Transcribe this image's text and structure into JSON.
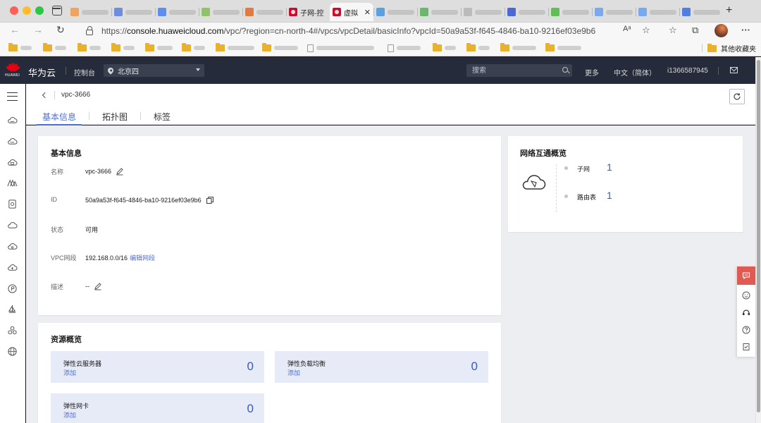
{
  "browser": {
    "tabs": [
      {
        "title": "",
        "active": false
      },
      {
        "title": "",
        "active": false
      },
      {
        "title": "",
        "active": false
      },
      {
        "title": "",
        "active": false
      },
      {
        "title": "",
        "active": false
      },
      {
        "title": "子网-控",
        "active": false
      },
      {
        "title": "虚拟",
        "active": true
      },
      {
        "title": "",
        "active": false
      },
      {
        "title": "",
        "active": false
      },
      {
        "title": "",
        "active": false
      },
      {
        "title": "",
        "active": false
      },
      {
        "title": "",
        "active": false
      },
      {
        "title": "",
        "active": false
      },
      {
        "title": "",
        "active": false
      },
      {
        "title": "",
        "active": false
      }
    ],
    "url_prefix": "https://",
    "url_host": "console.huaweicloud.com",
    "url_path": "/vpc/?region=cn-north-4#/vpcs/vpcDetail/basicInfo?vpcId=50a9a53f-f645-4846-ba10-9216ef03e9b6",
    "other_bookmarks": "其他收藏夹"
  },
  "header": {
    "brand_mark": "HUAWEI",
    "brand": "华为云",
    "console": "控制台",
    "region": "北京四",
    "search_placeholder": "搜索",
    "more": "更多",
    "language": "中文（简体）",
    "account": "i1366587945"
  },
  "page": {
    "title": "vpc-3666",
    "tabs": [
      "基本信息",
      "拓扑图",
      "标签"
    ]
  },
  "basic_info": {
    "title": "基本信息",
    "fields": [
      {
        "label": "名称",
        "value": "vpc-3666"
      },
      {
        "label": "ID",
        "value": "50a9a53f-f645-4846-ba10-9216ef03e9b6"
      },
      {
        "label": "状态",
        "value": "可用"
      },
      {
        "label": "VPC网段",
        "value": "192.168.0.0/16",
        "link": "编辑网段"
      },
      {
        "label": "描述",
        "value": "--"
      }
    ]
  },
  "network": {
    "title": "网络互通概览",
    "items": [
      {
        "label": "子网",
        "count": "1"
      },
      {
        "label": "路由表",
        "count": "1"
      }
    ]
  },
  "resources": {
    "title": "资源概览",
    "add_label": "添加",
    "items": [
      {
        "name": "弹性云服务器",
        "count": "0"
      },
      {
        "name": "弹性负载均衡",
        "count": "0"
      },
      {
        "name": "弹性网卡",
        "count": "0"
      }
    ]
  },
  "colors": {
    "header_bg": "#252b3a",
    "accent": "#526ecc",
    "number": "#3e59b0",
    "resource_bg": "#e7ebf8",
    "content_bg": "#edeef2",
    "chat_red": "#e05a52"
  }
}
